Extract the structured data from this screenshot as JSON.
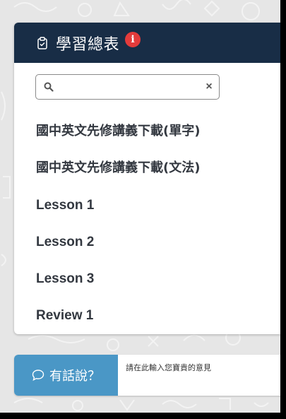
{
  "header": {
    "title": "學習總表",
    "info_badge": "i",
    "icon": "clipboard-check-icon"
  },
  "search": {
    "value": "",
    "placeholder": "",
    "search_icon": "search-icon",
    "clear_icon": "×"
  },
  "lessons": [
    {
      "label": "國中英文先修講義下載(單字)"
    },
    {
      "label": "國中英文先修講義下載(文法)"
    },
    {
      "label": "Lesson 1"
    },
    {
      "label": "Lesson 2"
    },
    {
      "label": "Lesson 3"
    },
    {
      "label": "Review 1"
    }
  ],
  "feedback": {
    "button_label": "有話說？",
    "input_placeholder": "請在此輸入您寶貴的意見",
    "icon": "chat-bubble-icon"
  },
  "colors": {
    "header_bg": "#182d46",
    "badge": "#e33b3b",
    "feedback_button": "#4a97c6",
    "page_bg": "#e6e6e6"
  }
}
